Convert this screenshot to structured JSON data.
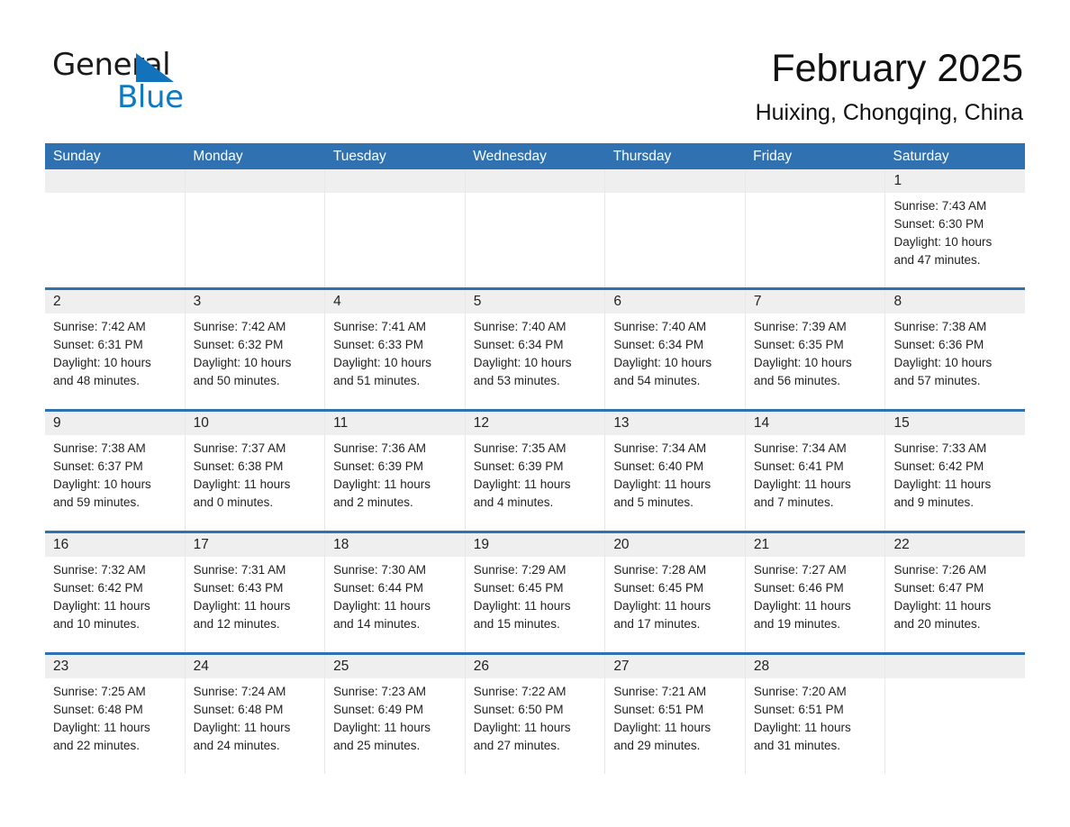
{
  "brand": {
    "name_part1": "General",
    "name_part2": "Blue",
    "triangle_color": "#1273bc",
    "blue_text_color": "#0b79c6"
  },
  "header": {
    "month_title": "February 2025",
    "location": "Huixing, Chongqing, China"
  },
  "theme": {
    "header_blue": "#3072b1",
    "day_band_gray": "#efefef",
    "text_color": "#222222"
  },
  "weekdays": [
    "Sunday",
    "Monday",
    "Tuesday",
    "Wednesday",
    "Thursday",
    "Friday",
    "Saturday"
  ],
  "weeks": [
    {
      "days": [
        {
          "num": "",
          "sunrise": "",
          "sunset": "",
          "daylight_line1": "",
          "daylight_line2": ""
        },
        {
          "num": "",
          "sunrise": "",
          "sunset": "",
          "daylight_line1": "",
          "daylight_line2": ""
        },
        {
          "num": "",
          "sunrise": "",
          "sunset": "",
          "daylight_line1": "",
          "daylight_line2": ""
        },
        {
          "num": "",
          "sunrise": "",
          "sunset": "",
          "daylight_line1": "",
          "daylight_line2": ""
        },
        {
          "num": "",
          "sunrise": "",
          "sunset": "",
          "daylight_line1": "",
          "daylight_line2": ""
        },
        {
          "num": "",
          "sunrise": "",
          "sunset": "",
          "daylight_line1": "",
          "daylight_line2": ""
        },
        {
          "num": "1",
          "sunrise": "Sunrise: 7:43 AM",
          "sunset": "Sunset: 6:30 PM",
          "daylight_line1": "Daylight: 10 hours",
          "daylight_line2": "and 47 minutes."
        }
      ]
    },
    {
      "days": [
        {
          "num": "2",
          "sunrise": "Sunrise: 7:42 AM",
          "sunset": "Sunset: 6:31 PM",
          "daylight_line1": "Daylight: 10 hours",
          "daylight_line2": "and 48 minutes."
        },
        {
          "num": "3",
          "sunrise": "Sunrise: 7:42 AM",
          "sunset": "Sunset: 6:32 PM",
          "daylight_line1": "Daylight: 10 hours",
          "daylight_line2": "and 50 minutes."
        },
        {
          "num": "4",
          "sunrise": "Sunrise: 7:41 AM",
          "sunset": "Sunset: 6:33 PM",
          "daylight_line1": "Daylight: 10 hours",
          "daylight_line2": "and 51 minutes."
        },
        {
          "num": "5",
          "sunrise": "Sunrise: 7:40 AM",
          "sunset": "Sunset: 6:34 PM",
          "daylight_line1": "Daylight: 10 hours",
          "daylight_line2": "and 53 minutes."
        },
        {
          "num": "6",
          "sunrise": "Sunrise: 7:40 AM",
          "sunset": "Sunset: 6:34 PM",
          "daylight_line1": "Daylight: 10 hours",
          "daylight_line2": "and 54 minutes."
        },
        {
          "num": "7",
          "sunrise": "Sunrise: 7:39 AM",
          "sunset": "Sunset: 6:35 PM",
          "daylight_line1": "Daylight: 10 hours",
          "daylight_line2": "and 56 minutes."
        },
        {
          "num": "8",
          "sunrise": "Sunrise: 7:38 AM",
          "sunset": "Sunset: 6:36 PM",
          "daylight_line1": "Daylight: 10 hours",
          "daylight_line2": "and 57 minutes."
        }
      ]
    },
    {
      "days": [
        {
          "num": "9",
          "sunrise": "Sunrise: 7:38 AM",
          "sunset": "Sunset: 6:37 PM",
          "daylight_line1": "Daylight: 10 hours",
          "daylight_line2": "and 59 minutes."
        },
        {
          "num": "10",
          "sunrise": "Sunrise: 7:37 AM",
          "sunset": "Sunset: 6:38 PM",
          "daylight_line1": "Daylight: 11 hours",
          "daylight_line2": "and 0 minutes."
        },
        {
          "num": "11",
          "sunrise": "Sunrise: 7:36 AM",
          "sunset": "Sunset: 6:39 PM",
          "daylight_line1": "Daylight: 11 hours",
          "daylight_line2": "and 2 minutes."
        },
        {
          "num": "12",
          "sunrise": "Sunrise: 7:35 AM",
          "sunset": "Sunset: 6:39 PM",
          "daylight_line1": "Daylight: 11 hours",
          "daylight_line2": "and 4 minutes."
        },
        {
          "num": "13",
          "sunrise": "Sunrise: 7:34 AM",
          "sunset": "Sunset: 6:40 PM",
          "daylight_line1": "Daylight: 11 hours",
          "daylight_line2": "and 5 minutes."
        },
        {
          "num": "14",
          "sunrise": "Sunrise: 7:34 AM",
          "sunset": "Sunset: 6:41 PM",
          "daylight_line1": "Daylight: 11 hours",
          "daylight_line2": "and 7 minutes."
        },
        {
          "num": "15",
          "sunrise": "Sunrise: 7:33 AM",
          "sunset": "Sunset: 6:42 PM",
          "daylight_line1": "Daylight: 11 hours",
          "daylight_line2": "and 9 minutes."
        }
      ]
    },
    {
      "days": [
        {
          "num": "16",
          "sunrise": "Sunrise: 7:32 AM",
          "sunset": "Sunset: 6:42 PM",
          "daylight_line1": "Daylight: 11 hours",
          "daylight_line2": "and 10 minutes."
        },
        {
          "num": "17",
          "sunrise": "Sunrise: 7:31 AM",
          "sunset": "Sunset: 6:43 PM",
          "daylight_line1": "Daylight: 11 hours",
          "daylight_line2": "and 12 minutes."
        },
        {
          "num": "18",
          "sunrise": "Sunrise: 7:30 AM",
          "sunset": "Sunset: 6:44 PM",
          "daylight_line1": "Daylight: 11 hours",
          "daylight_line2": "and 14 minutes."
        },
        {
          "num": "19",
          "sunrise": "Sunrise: 7:29 AM",
          "sunset": "Sunset: 6:45 PM",
          "daylight_line1": "Daylight: 11 hours",
          "daylight_line2": "and 15 minutes."
        },
        {
          "num": "20",
          "sunrise": "Sunrise: 7:28 AM",
          "sunset": "Sunset: 6:45 PM",
          "daylight_line1": "Daylight: 11 hours",
          "daylight_line2": "and 17 minutes."
        },
        {
          "num": "21",
          "sunrise": "Sunrise: 7:27 AM",
          "sunset": "Sunset: 6:46 PM",
          "daylight_line1": "Daylight: 11 hours",
          "daylight_line2": "and 19 minutes."
        },
        {
          "num": "22",
          "sunrise": "Sunrise: 7:26 AM",
          "sunset": "Sunset: 6:47 PM",
          "daylight_line1": "Daylight: 11 hours",
          "daylight_line2": "and 20 minutes."
        }
      ]
    },
    {
      "days": [
        {
          "num": "23",
          "sunrise": "Sunrise: 7:25 AM",
          "sunset": "Sunset: 6:48 PM",
          "daylight_line1": "Daylight: 11 hours",
          "daylight_line2": "and 22 minutes."
        },
        {
          "num": "24",
          "sunrise": "Sunrise: 7:24 AM",
          "sunset": "Sunset: 6:48 PM",
          "daylight_line1": "Daylight: 11 hours",
          "daylight_line2": "and 24 minutes."
        },
        {
          "num": "25",
          "sunrise": "Sunrise: 7:23 AM",
          "sunset": "Sunset: 6:49 PM",
          "daylight_line1": "Daylight: 11 hours",
          "daylight_line2": "and 25 minutes."
        },
        {
          "num": "26",
          "sunrise": "Sunrise: 7:22 AM",
          "sunset": "Sunset: 6:50 PM",
          "daylight_line1": "Daylight: 11 hours",
          "daylight_line2": "and 27 minutes."
        },
        {
          "num": "27",
          "sunrise": "Sunrise: 7:21 AM",
          "sunset": "Sunset: 6:51 PM",
          "daylight_line1": "Daylight: 11 hours",
          "daylight_line2": "and 29 minutes."
        },
        {
          "num": "28",
          "sunrise": "Sunrise: 7:20 AM",
          "sunset": "Sunset: 6:51 PM",
          "daylight_line1": "Daylight: 11 hours",
          "daylight_line2": "and 31 minutes."
        },
        {
          "num": "",
          "sunrise": "",
          "sunset": "",
          "daylight_line1": "",
          "daylight_line2": ""
        }
      ]
    }
  ]
}
